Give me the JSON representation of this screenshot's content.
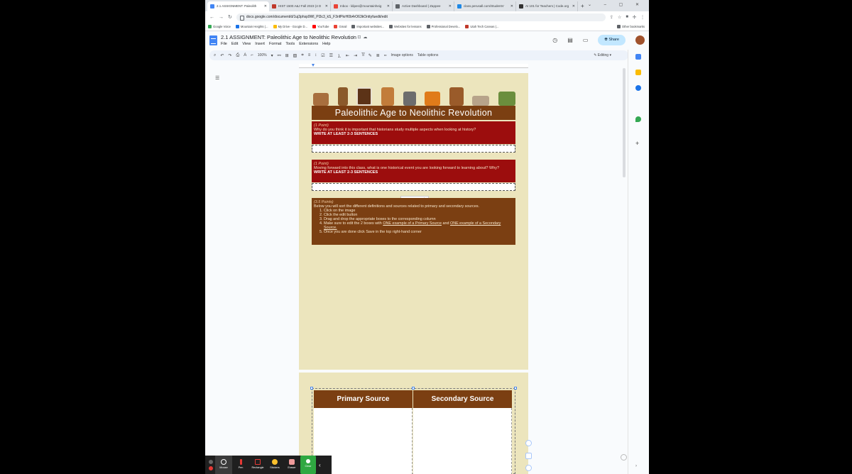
{
  "browser": {
    "tabs": [
      {
        "title": "2.1 ASSIGNMENT: Paleolith",
        "color": "#4285f4",
        "active": true
      },
      {
        "title": "HIST 1500 A&J Fall 2023 (4 D",
        "color": "#c0392b"
      },
      {
        "title": "Inbox - ldipes@mountainheig",
        "color": "#ea4335"
      },
      {
        "title": "Active Dashboard | Zappee",
        "color": "#5f6368"
      },
      {
        "title": "class.perusall.com/StudentV",
        "color": "#1e88e5"
      },
      {
        "title": "AI 101 for Teachers | Code.org",
        "color": "#333333"
      }
    ],
    "url": "docs.google.com/document/d/1uj3phsp9Wl_Pl3c3_kS_F3nfPkrH0b4rO63kOnttyfuedit/edit",
    "bookmarks": [
      {
        "label": "Google Voice",
        "color": "#34a853"
      },
      {
        "label": "Mountain Heights (...",
        "color": "#1a73e8"
      },
      {
        "label": "My Drive - Google D...",
        "color": "#fbbc04"
      },
      {
        "label": "YouTube",
        "color": "#ff0000"
      },
      {
        "label": "Gmail",
        "color": "#ea4335"
      },
      {
        "label": "Important websites...",
        "color": "#5f6368"
      },
      {
        "label": "Websites for lessons",
        "color": "#5f6368"
      },
      {
        "label": "Professional Develo...",
        "color": "#5f6368"
      },
      {
        "label": "Utah Tech Canvas (...",
        "color": "#c0392b"
      }
    ],
    "other_bookmarks": "Other bookmarks"
  },
  "docs": {
    "title": "2.1 ASSIGNMENT: Paleolithic Age to Neolithic Revolution",
    "menus": [
      "File",
      "Edit",
      "View",
      "Insert",
      "Format",
      "Tools",
      "Extensions",
      "Help"
    ],
    "share_label": "Share",
    "zoom": "100%",
    "image_options": "Image options",
    "table_options": "Table options",
    "mode": "Editing"
  },
  "page1": {
    "banner": "Paleolithic Age to Neolithic Revolution",
    "q1": {
      "points": "(1 Point)",
      "text": "Why do you think it is important that historians study multiple aspects when looking at history?",
      "req": "WRITE AT LEAST 2-3 SENTENCES"
    },
    "q2": {
      "points": "(1 Point)",
      "text": "Moving forward into this class, what is one historical event you are looking forward to learning about? Why?",
      "req": "WRITE AT LEAST 2-3 SENTENCES"
    },
    "q3": {
      "points": "(3.5 Points)",
      "text": "Below you will sort the different definitions and sources related to primary and secondary sources.",
      "steps": {
        "s1": "Click on the image",
        "s2": "Click the edit button",
        "s3": "Drag and drop the appropriate boxes to the corresponding column",
        "s4_a": "Make sure to edit the 2 boxes with ",
        "s4_b": "ONE example of a Primary Source",
        "s4_c": " and ",
        "s4_d": "ONE example of a Secondary Source.",
        "s5": "Once you are done click Save in the top right-hand corner"
      }
    }
  },
  "page2": {
    "primary_header": "Primary Source",
    "secondary_header": "Secondary Source"
  },
  "zoom_controls": {
    "items": [
      "Mouse",
      "Pen",
      "Rectangle",
      "Stickers",
      "Eraser",
      "Clear"
    ],
    "green_label": "Check Annotation"
  },
  "colors": {
    "brown": "#7b3f12",
    "red": "#9c0d0d",
    "page_bg": "#ece5bd"
  }
}
